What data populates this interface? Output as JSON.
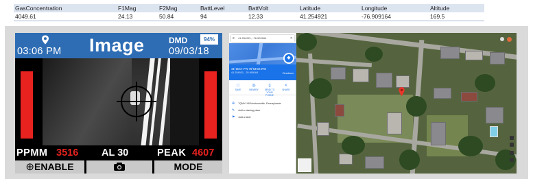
{
  "table": {
    "headers": [
      "GasConcentration",
      "F1Mag",
      "F2Mag",
      "BattLevel",
      "BattVolt",
      "Latitude",
      "Longitude",
      "Altitude"
    ],
    "row": [
      "4049.61",
      "24.13",
      "50.84",
      "94",
      "12.33",
      "41.254921",
      "-76.909164",
      "169.5"
    ]
  },
  "device": {
    "time": "03:06 PM",
    "title": "Image",
    "mode": "DMD",
    "battery": "94%",
    "date": "09/03/18",
    "ppmm_label": "PPMM",
    "ppmm_value": "3516",
    "al_label": "AL 30",
    "peak_label": "PEAK",
    "peak_value": "4607",
    "enable_glyph": "⊕",
    "enable_label": "ENABLE",
    "camera_glyph": "📷",
    "mode_label": "MODE",
    "colors": {
      "header_blue": "#2e6db4",
      "alert_red": "#e7221f"
    },
    "icons": [
      "location-pin-icon",
      "crosshair-icon",
      "camera-icon",
      "enable-target-icon"
    ]
  },
  "maps": {
    "search_text": "41.254921, -76.909164",
    "coords_main": "41°15'17.7\"N 76°54'32.9\"W",
    "coords_sub": "41.254921, -76.909164",
    "directions_label": "Directions",
    "actions": [
      {
        "icon": "□",
        "label": "SAVE"
      },
      {
        "icon": "◎",
        "label": "NEARBY"
      },
      {
        "icon": "▯",
        "label": "SEND TO YOUR PHONE"
      },
      {
        "icon": "<",
        "label": "SHARE"
      }
    ],
    "info": [
      {
        "icon": "✣",
        "text": "7QMV+X8 Montoursville, Pennsylvania"
      },
      {
        "icon": "✎",
        "text": "Add a missing place"
      },
      {
        "icon": "⚑",
        "text": "Add a label"
      }
    ]
  }
}
